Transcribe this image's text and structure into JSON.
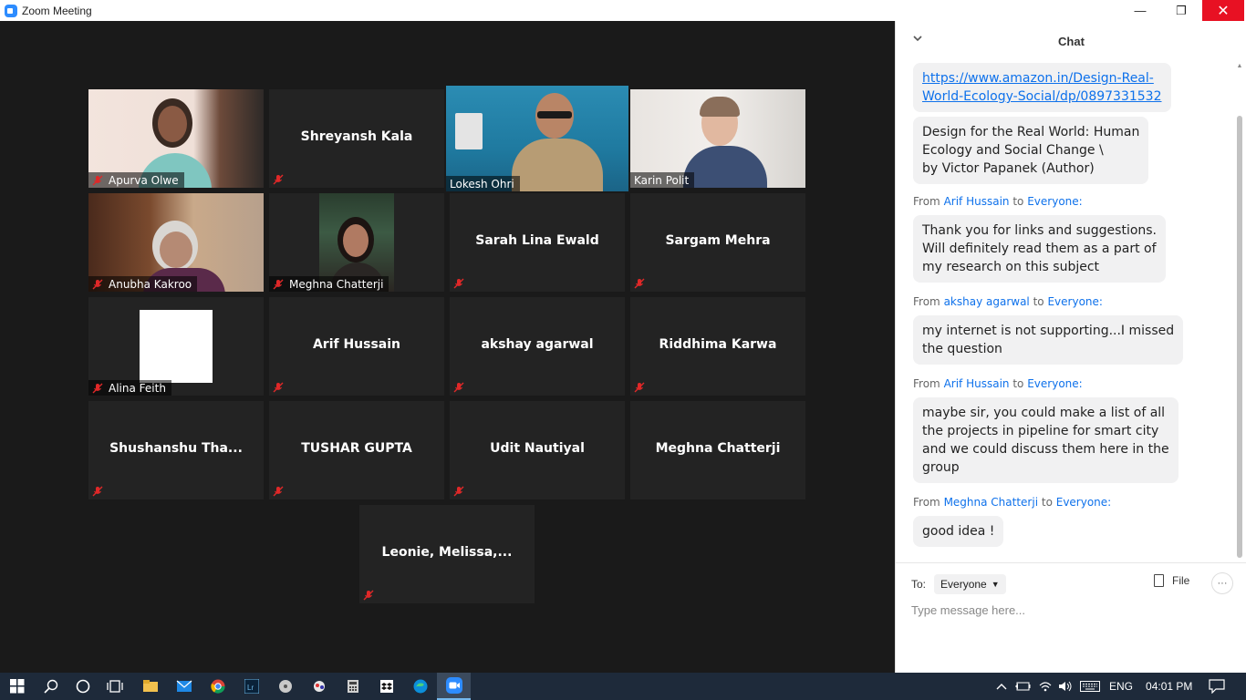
{
  "window": {
    "title": "Zoom Meeting",
    "minimize_glyph": "—",
    "maximize_glyph": "❐",
    "close_glyph": "✕"
  },
  "participants": [
    {
      "name": "Apurva Olwe",
      "video": true,
      "muted": true
    },
    {
      "name": "Shreyansh Kala",
      "video": false,
      "muted": true
    },
    {
      "name": "Lokesh Ohri",
      "video": true,
      "muted": false,
      "active_speaker": true
    },
    {
      "name": "Karin Polit",
      "video": true,
      "muted": false
    },
    {
      "name": "Anubha Kakroo",
      "video": true,
      "muted": true
    },
    {
      "name": "Meghna Chatterji",
      "video": true,
      "muted": true
    },
    {
      "name": "Sarah Lina Ewald",
      "video": false,
      "muted": true
    },
    {
      "name": "Sargam Mehra",
      "video": false,
      "muted": true
    },
    {
      "name": "Alina Feith",
      "video": true,
      "muted": true
    },
    {
      "name": "Arif Hussain",
      "video": false,
      "muted": true
    },
    {
      "name": "akshay agarwal",
      "video": false,
      "muted": true
    },
    {
      "name": "Riddhima Karwa",
      "video": false,
      "muted": true
    },
    {
      "name": "Shushanshu  Tha...",
      "video": false,
      "muted": true
    },
    {
      "name": "TUSHAR GUPTA",
      "video": false,
      "muted": true
    },
    {
      "name": "Udit Nautiyal",
      "video": false,
      "muted": true
    },
    {
      "name": "Meghna Chatterji",
      "video": false,
      "muted": false
    },
    {
      "name": "Leonie,  Melissa,...",
      "video": false,
      "muted": true
    }
  ],
  "chat": {
    "title": "Chat",
    "messages": [
      {
        "link_line1": "https://www.amazon.in/Design-Real-",
        "link_line2": "World-Ecology-Social/dp/0897331532"
      },
      {
        "lines": [
          "Design for the Real World: Human",
          "Ecology and Social Change \\",
          "by  Victor Papanek  (Author)"
        ]
      },
      {
        "from": "Arif Hussain",
        "to": "Everyone:",
        "lines": [
          "Thank you for links and suggestions.",
          "Will definitely read them as a part of",
          "my research on this subject"
        ]
      },
      {
        "from": "akshay agarwal",
        "to": "Everyone:",
        "lines": [
          "my internet is not supporting...I missed",
          "the question"
        ]
      },
      {
        "from": "Arif Hussain",
        "to": "Everyone:",
        "lines": [
          "maybe sir, you could make a list of all",
          "the projects in pipeline for smart city",
          "and we could discuss them here in the",
          "group"
        ]
      },
      {
        "from": "Meghna Chatterji",
        "to": "Everyone:",
        "lines": [
          "good idea !"
        ]
      }
    ],
    "from_word": "From",
    "to_word": "to",
    "to_label": "To:",
    "recipient": "Everyone",
    "file_label": "File",
    "more_label": "···",
    "input_placeholder": "Type message here..."
  },
  "taskbar": {
    "language": "ENG",
    "time": "04:01 PM",
    "apps": [
      "windows-start",
      "search",
      "cortana",
      "task-view",
      "file-explorer",
      "mail",
      "chrome",
      "lightroom",
      "disk-app",
      "snipping-app",
      "calculator",
      "dropbox",
      "edge",
      "zoom"
    ]
  },
  "colors": {
    "active_speaker": "#c7e541",
    "link": "#0e71eb",
    "muted_icon": "#e02828"
  }
}
